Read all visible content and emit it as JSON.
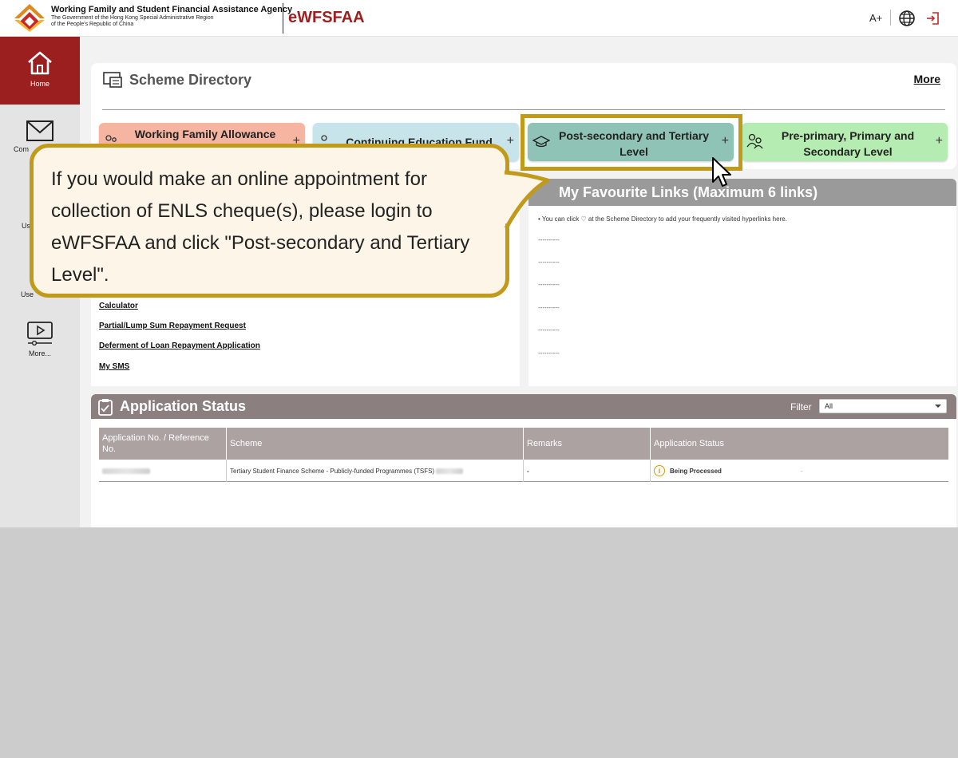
{
  "header": {
    "agency_name": "Working Family and Student Financial Assistance Agency",
    "agency_sub1": "The Government of the Hong Kong Special Administrative Region",
    "agency_sub2": "of the People's Republic of China",
    "app_title": "eWFSFAA",
    "font_size_label": "A+",
    "lang_icon": "globe-icon",
    "logout_icon": "logout-icon",
    "brand_color": "#9c1f1f"
  },
  "sidebar": {
    "items": [
      {
        "label": "Home",
        "icon": "home-icon"
      },
      {
        "label": "Com",
        "icon": "mail-icon"
      },
      {
        "label": "Us",
        "icon": "user-icon"
      },
      {
        "label": "Use",
        "icon": "user-guide-icon"
      },
      {
        "label": "More...",
        "icon": "video-icon"
      }
    ]
  },
  "scheme_directory": {
    "title": "Scheme Directory",
    "more_label": "More",
    "tabs": [
      {
        "label": "Working Family Allowance",
        "color": "#f5b5a1"
      },
      {
        "label": "Continuing Education Fund",
        "color": "#c7e4eb"
      },
      {
        "label": "Post-secondary and Tertiary Level",
        "color": "#8fc3b6"
      },
      {
        "label": "Pre-primary, Primary and Secondary Level",
        "color": "#b5ecb1"
      }
    ]
  },
  "links": [
    "Calculator",
    "Partial/Lump Sum Repayment Request",
    "Deferment of Loan Repayment Application",
    "My SMS"
  ],
  "favourites": {
    "title": "My Favourite Links (Maximum 6 links)",
    "note": "• You can click ♡ at the Scheme Directory to add your frequently visited hyperlinks here.",
    "slots": [
      "----------",
      "----------",
      "----------",
      "----------",
      "----------",
      "----------"
    ]
  },
  "application_status": {
    "title": "Application Status",
    "filter_label": "Filter",
    "filter_value": "All",
    "columns": [
      "Application No. / Reference No.",
      "Scheme",
      "Remarks",
      "Application Status"
    ],
    "rows": [
      {
        "scheme": "Tertiary Student Finance Scheme - Publicly-funded Programmes (TSFS)",
        "remarks": "-",
        "status": "Being Processed",
        "extra": "-"
      }
    ]
  },
  "callout": {
    "text": "If you would make an online appointment for collection of ENLS cheque(s), please login to eWFSFAA and click \"Post-secondary and Tertiary Level\".",
    "border_color": "#c19a19"
  }
}
